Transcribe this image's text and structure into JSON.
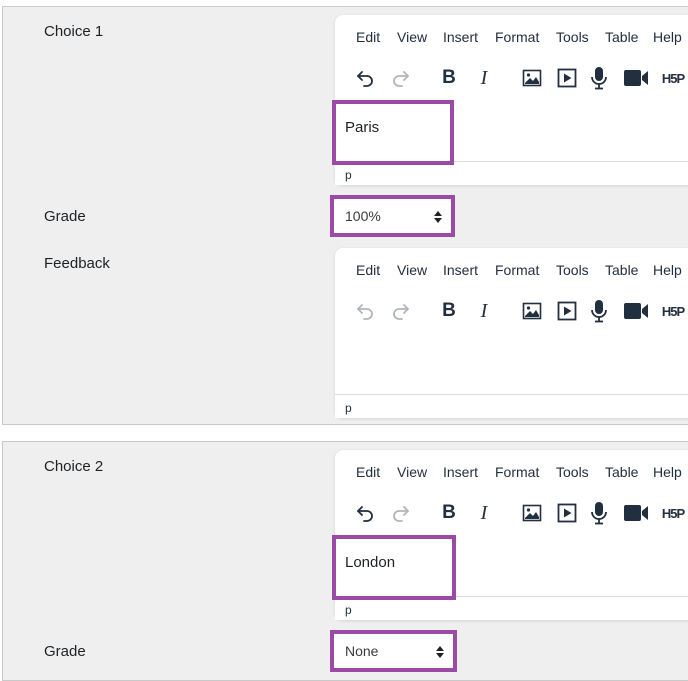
{
  "menu": [
    "Edit",
    "View",
    "Insert",
    "Format",
    "Tools",
    "Table",
    "Help"
  ],
  "choice1": {
    "label": "Choice 1",
    "content": "Paris",
    "status": "p",
    "grade_label": "Grade",
    "grade_value": "100%",
    "feedback_label": "Feedback",
    "feedback_status": "p"
  },
  "choice2": {
    "label": "Choice 2",
    "content": "London",
    "status": "p",
    "grade_label": "Grade",
    "grade_value": "None"
  },
  "icons": [
    "undo-icon",
    "redo-icon",
    "bold-icon",
    "italic-icon",
    "image-icon",
    "media-icon",
    "microphone-icon",
    "video-camera-icon",
    "h5p-icon"
  ],
  "toolbar": {
    "bold": "B",
    "italic": "I",
    "h5p": "H5P"
  },
  "colors": {
    "highlight": "#9b4aa6",
    "panel": "#efefef",
    "toolbar_icon": "#222f3e"
  }
}
